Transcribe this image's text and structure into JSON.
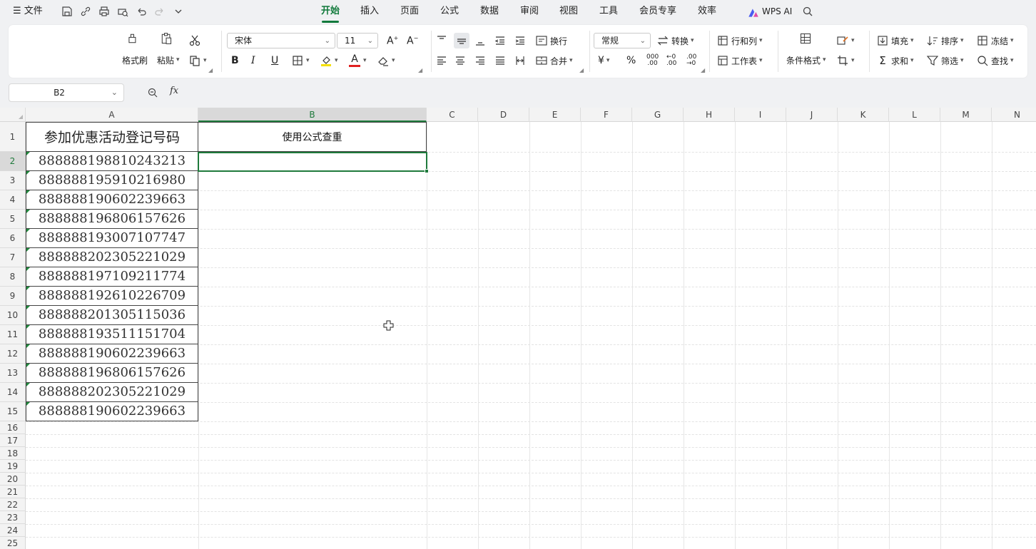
{
  "menu": {
    "file_label": "文件",
    "tabs": [
      "开始",
      "插入",
      "页面",
      "公式",
      "数据",
      "审阅",
      "视图",
      "工具",
      "会员专享",
      "效率"
    ],
    "active_tab": "开始",
    "ai_label": "WPS AI"
  },
  "ribbon": {
    "format_painter": "格式刷",
    "paste": "粘贴",
    "font_name": "宋体",
    "font_size": "11",
    "wrap": "换行",
    "merge": "合并",
    "number_format": "常规",
    "convert": "转换",
    "rows_cols": "行和列",
    "worksheet": "工作表",
    "conditional_format": "条件格式",
    "fill": "填充",
    "sort": "排序",
    "freeze": "冻结",
    "sum": "求和",
    "filter": "筛选",
    "find": "查找",
    "bold": "B",
    "italic": "I",
    "underline": "U",
    "font_color_letter": "A",
    "accent_color": "#127a3c",
    "font_color": "#e02020",
    "highlight_color": "#f5e000"
  },
  "formula_bar": {
    "name_box": "B2",
    "fx_label": "fx",
    "formula": ""
  },
  "sheet": {
    "columns": [
      "A",
      "B",
      "C",
      "D",
      "E",
      "F",
      "G",
      "H",
      "I",
      "J",
      "K",
      "L",
      "M",
      "N"
    ],
    "selected_column": "B",
    "rows": [
      "1",
      "2",
      "3",
      "4",
      "5",
      "6",
      "7",
      "8",
      "9",
      "10",
      "11",
      "12",
      "13",
      "14",
      "15",
      "16",
      "17",
      "18",
      "19",
      "20",
      "21",
      "22",
      "23",
      "24",
      "25"
    ],
    "selected_row": "2",
    "header_a": "参加优惠活动登记号码",
    "header_b": "使用公式查重",
    "values_a": [
      "888888198810243213",
      "888888195910216980",
      "888888190602239663",
      "888888196806157626",
      "888888193007107747",
      "888888202305221029",
      "888888197109211774",
      "888888192610226709",
      "888888201305115036",
      "888888193511151704",
      "888888190602239663",
      "888888196806157626",
      "888888202305221029",
      "888888190602239663"
    ]
  }
}
